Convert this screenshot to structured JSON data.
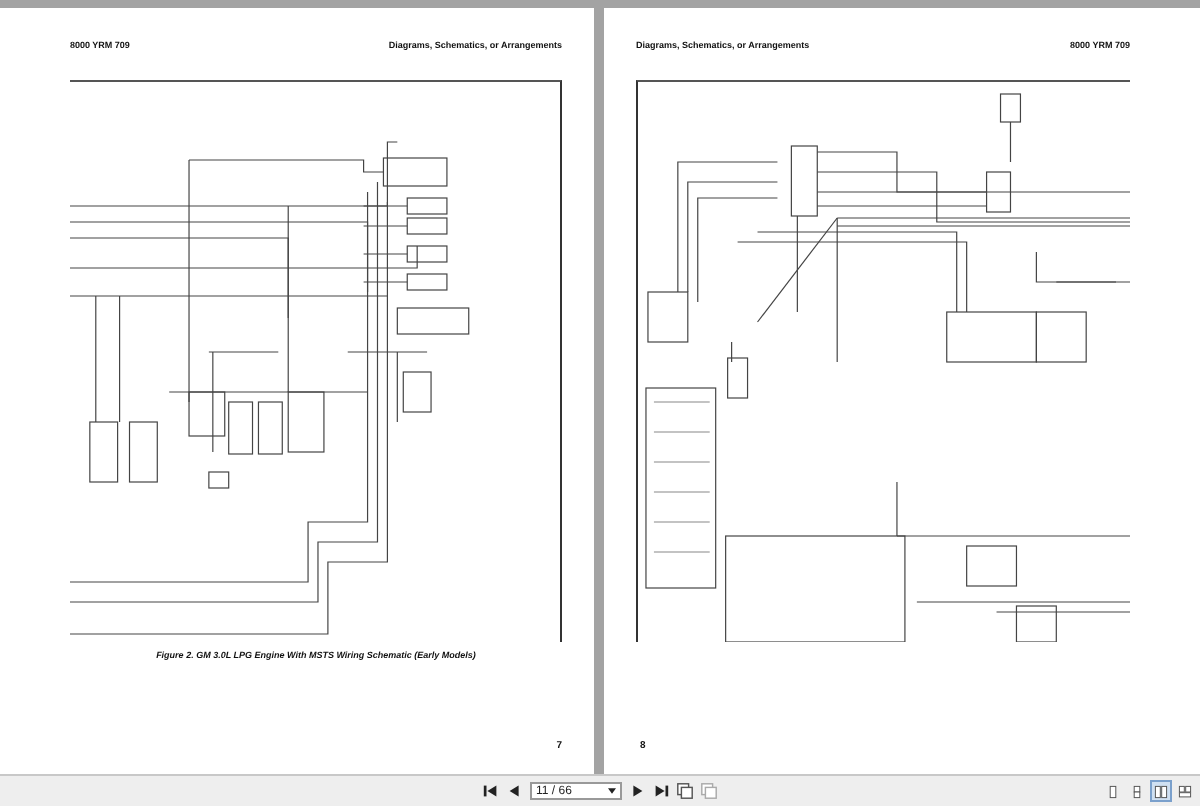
{
  "pages": [
    {
      "kind": "left",
      "header_left": "8000 YRM 709",
      "header_right": "Diagrams, Schematics, or Arrangements",
      "caption": "Figure 2. GM 3.0L LPG Engine With MSTS Wiring Schematic (Early Models)",
      "page_number": "7"
    },
    {
      "kind": "right",
      "header_left": "Diagrams, Schematics, or Arrangements",
      "header_right": "8000 YRM 709",
      "page_number": "8"
    }
  ],
  "toolbar": {
    "page_field": "11 / 66",
    "view_modes": [
      {
        "selected": false
      },
      {
        "selected": false
      },
      {
        "selected": true
      },
      {
        "selected": false
      }
    ]
  }
}
